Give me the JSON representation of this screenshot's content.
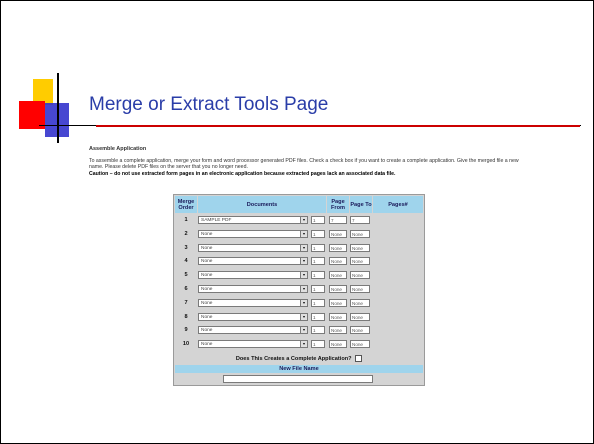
{
  "slide": {
    "title": "Merge or Extract Tools Page"
  },
  "assemble": {
    "heading": "Assemble Application",
    "instructions_1": "To assemble a complete application, merge your form and word processor generated PDF files. Check a check box if you want to create a complete application. Give the merged file a new name. Please delete PDF files on the server that you no longer need.",
    "caution": "Caution – do not use extracted form pages in an electronic application because extracted pages lack an associated data file."
  },
  "table": {
    "headers": {
      "merge_order": "Merge Order",
      "documents": "Documents",
      "page_from": "Page From",
      "page_to": "Page To",
      "pages": "Pages#"
    },
    "rows": [
      {
        "order": "1",
        "document": "SAMPLE PDF",
        "from": "1",
        "to": "7",
        "pages": "7"
      },
      {
        "order": "2",
        "document": "None",
        "from": "1",
        "to": "None",
        "pages": "None"
      },
      {
        "order": "3",
        "document": "None",
        "from": "1",
        "to": "None",
        "pages": "None"
      },
      {
        "order": "4",
        "document": "None",
        "from": "1",
        "to": "None",
        "pages": "None"
      },
      {
        "order": "5",
        "document": "None",
        "from": "1",
        "to": "None",
        "pages": "None"
      },
      {
        "order": "6",
        "document": "None",
        "from": "1",
        "to": "None",
        "pages": "None"
      },
      {
        "order": "7",
        "document": "None",
        "from": "1",
        "to": "None",
        "pages": "None"
      },
      {
        "order": "8",
        "document": "None",
        "from": "1",
        "to": "None",
        "pages": "None"
      },
      {
        "order": "9",
        "document": "None",
        "from": "1",
        "to": "None",
        "pages": "None"
      },
      {
        "order": "10",
        "document": "None",
        "from": "1",
        "to": "None",
        "pages": "None"
      }
    ],
    "complete_question": "Does This Creates a Complete Application?",
    "new_file_label": "New File Name",
    "new_file_value": ""
  },
  "colors": {
    "title": "#2a3da8",
    "header_bg": "#9fd4ec",
    "accent_red": "#cc0000",
    "deco_yellow": "#ffcc00",
    "deco_blue": "#3333cc"
  }
}
